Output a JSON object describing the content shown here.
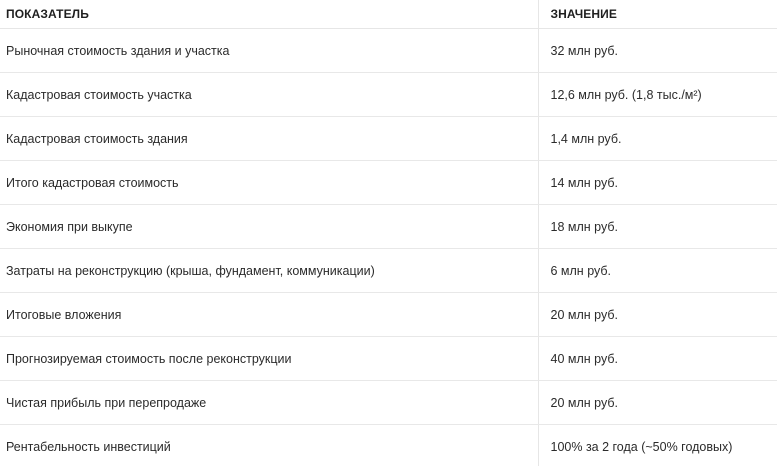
{
  "table": {
    "headers": [
      "ПОКАЗАТЕЛЬ",
      "ЗНАЧЕНИЕ"
    ],
    "rows": [
      {
        "label": "Рыночная стоимость здания и участка",
        "value": "32 млн руб."
      },
      {
        "label": "Кадастровая стоимость участка",
        "value": "12,6 млн руб. (1,8 тыс./м²)"
      },
      {
        "label": "Кадастровая стоимость здания",
        "value": "1,4 млн руб."
      },
      {
        "label": "Итого кадастровая стоимость",
        "value": "14 млн руб."
      },
      {
        "label": "Экономия при выкупе",
        "value": "18 млн руб."
      },
      {
        "label": "Затраты на реконструкцию (крыша, фундамент, коммуникации)",
        "value": "6 млн руб."
      },
      {
        "label": "Итоговые вложения",
        "value": "20 млн руб."
      },
      {
        "label": "Прогнозируемая стоимость после реконструкции",
        "value": "40 млн руб."
      },
      {
        "label": "Чистая прибыль при перепродаже",
        "value": "20 млн руб."
      },
      {
        "label": "Рентабельность инвестиций",
        "value": "100% за 2 года (~50% годовых)"
      }
    ]
  }
}
